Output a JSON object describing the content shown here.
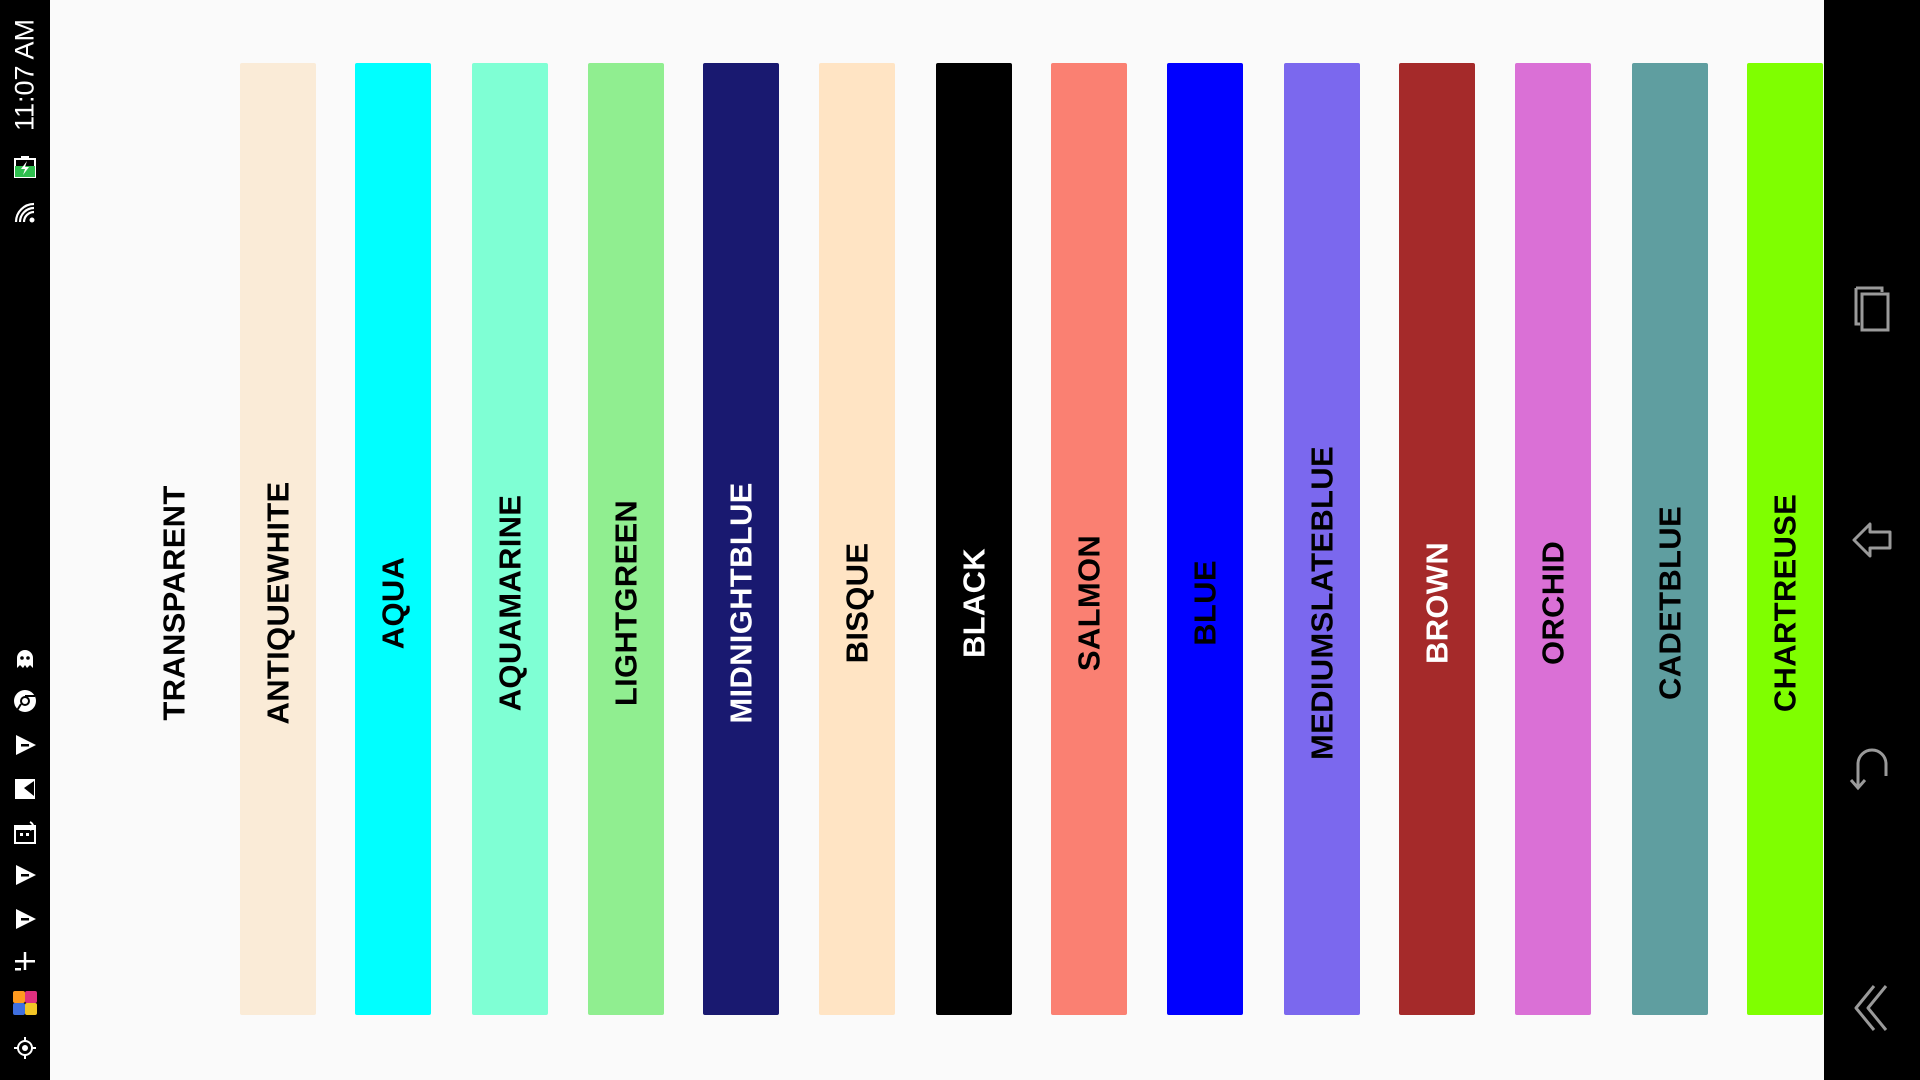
{
  "status_bar": {
    "time": "11:07 AM",
    "icons": [
      "battery-charging-icon",
      "wifi-icon",
      "ghost-icon",
      "chrome-icon",
      "warning-icon",
      "image-icon",
      "calendar-icon",
      "warning-icon",
      "warning-icon",
      "download-icon",
      "multi-app-icon",
      "gps-icon"
    ]
  },
  "swatches": [
    {
      "label": "TRANSPARENT",
      "color": "transparent",
      "text_color": "#000000"
    },
    {
      "label": "ANTIQUEWHITE",
      "color": "#FAEBD7",
      "text_color": "#000000"
    },
    {
      "label": "AQUA",
      "color": "#00FFFF",
      "text_color": "#000000"
    },
    {
      "label": "AQUAMARINE",
      "color": "#7FFFD4",
      "text_color": "#000000"
    },
    {
      "label": "LIGHTGREEN",
      "color": "#90EE90",
      "text_color": "#000000"
    },
    {
      "label": "MIDNIGHTBLUE",
      "color": "#191970",
      "text_color": "#FFFFFF"
    },
    {
      "label": "BISQUE",
      "color": "#FFE4C4",
      "text_color": "#000000"
    },
    {
      "label": "BLACK",
      "color": "#000000",
      "text_color": "#FFFFFF"
    },
    {
      "label": "SALMON",
      "color": "#FA8072",
      "text_color": "#000000"
    },
    {
      "label": "BLUE",
      "color": "#0000FF",
      "text_color": "#000000"
    },
    {
      "label": "MEDIUMSLATEBLUE",
      "color": "#7B68EE",
      "text_color": "#000000"
    },
    {
      "label": "BROWN",
      "color": "#A52A2A",
      "text_color": "#FFFFFF"
    },
    {
      "label": "ORCHID",
      "color": "#DA70D6",
      "text_color": "#000000"
    },
    {
      "label": "CADETBLUE",
      "color": "#5F9EA0",
      "text_color": "#000000"
    },
    {
      "label": "CHARTREUSE",
      "color": "#7FFF00",
      "text_color": "#000000"
    }
  ],
  "nav_bar": {
    "buttons": [
      {
        "name": "recent-apps-button",
        "icon": "recent-apps-icon"
      },
      {
        "name": "home-button",
        "icon": "home-icon"
      },
      {
        "name": "back-button",
        "icon": "back-icon"
      },
      {
        "name": "collapse-button",
        "icon": "collapse-icon"
      }
    ]
  }
}
